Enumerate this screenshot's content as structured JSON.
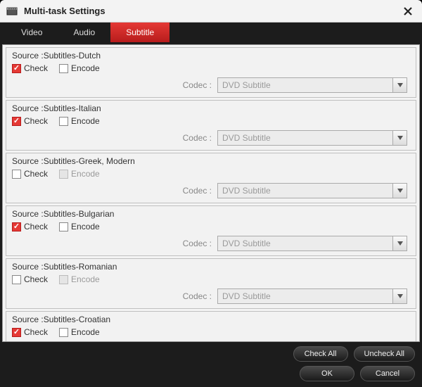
{
  "window": {
    "title": "Multi-task Settings"
  },
  "tabs": {
    "video": "Video",
    "audio": "Audio",
    "subtitle": "Subtitle",
    "active": "subtitle"
  },
  "labels": {
    "source_prefix": "Source :",
    "check": "Check",
    "encode": "Encode",
    "codec": "Codec :",
    "codec_value": "DVD Subtitle"
  },
  "buttons": {
    "check_all": "Check All",
    "uncheck_all": "Uncheck All",
    "ok": "OK",
    "cancel": "Cancel"
  },
  "subtitles": [
    {
      "name": "Subtitles-Dutch",
      "checked": true,
      "encode": false,
      "encode_disabled": false
    },
    {
      "name": "Subtitles-Italian",
      "checked": true,
      "encode": false,
      "encode_disabled": false
    },
    {
      "name": "Subtitles-Greek, Modern",
      "checked": false,
      "encode": false,
      "encode_disabled": true
    },
    {
      "name": "Subtitles-Bulgarian",
      "checked": true,
      "encode": false,
      "encode_disabled": false
    },
    {
      "name": "Subtitles-Romanian",
      "checked": false,
      "encode": false,
      "encode_disabled": true
    },
    {
      "name": "Subtitles-Croatian",
      "checked": true,
      "encode": false,
      "encode_disabled": false
    }
  ]
}
